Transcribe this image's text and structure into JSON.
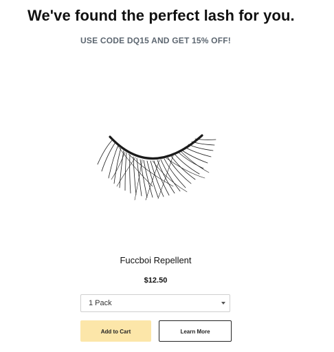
{
  "header": {
    "headline": "We've found the perfect lash for you.",
    "promo": "USE CODE DQ15 AND GET 15% OFF!"
  },
  "product": {
    "image_icon": "eyelash-product-image",
    "name": "Fuccboi Repellent",
    "price": "$12.50",
    "pack_select": {
      "selected": "1 Pack"
    },
    "add_to_cart_label": "Add to Cart",
    "learn_more_label": "Learn More"
  },
  "colors": {
    "add_to_cart_bg": "#fce6a9",
    "promo_text": "#5c6670",
    "border": "#222222"
  }
}
